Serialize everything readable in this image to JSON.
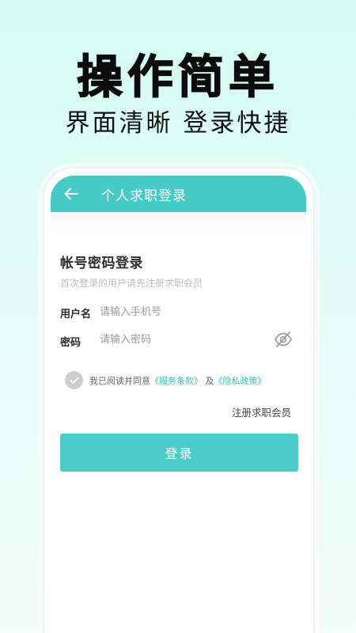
{
  "promo": {
    "headline": "操作简单",
    "subline": "界面清晰 登录快捷"
  },
  "appbar": {
    "back_icon": "arrow-left-icon",
    "title": "个人求职登录"
  },
  "form": {
    "section_title": "帐号密码登录",
    "hint": "首次登录的用户请先注册求职会员",
    "username_label": "用户名",
    "username_placeholder": "请输入手机号",
    "password_label": "密码",
    "password_placeholder": "请输入密码",
    "visibility_icon": "eye-off-icon"
  },
  "agreement": {
    "prefix": "我已阅读并同意",
    "terms_link": "《服务条款》",
    "joiner": " 及",
    "privacy_link": "《隐私政策》"
  },
  "register_link": "注册求职会员",
  "login_button": "登录",
  "colors": {
    "accent": "#47c9c6",
    "link": "#3fbcb9",
    "background_top": "#d3fbf2"
  }
}
